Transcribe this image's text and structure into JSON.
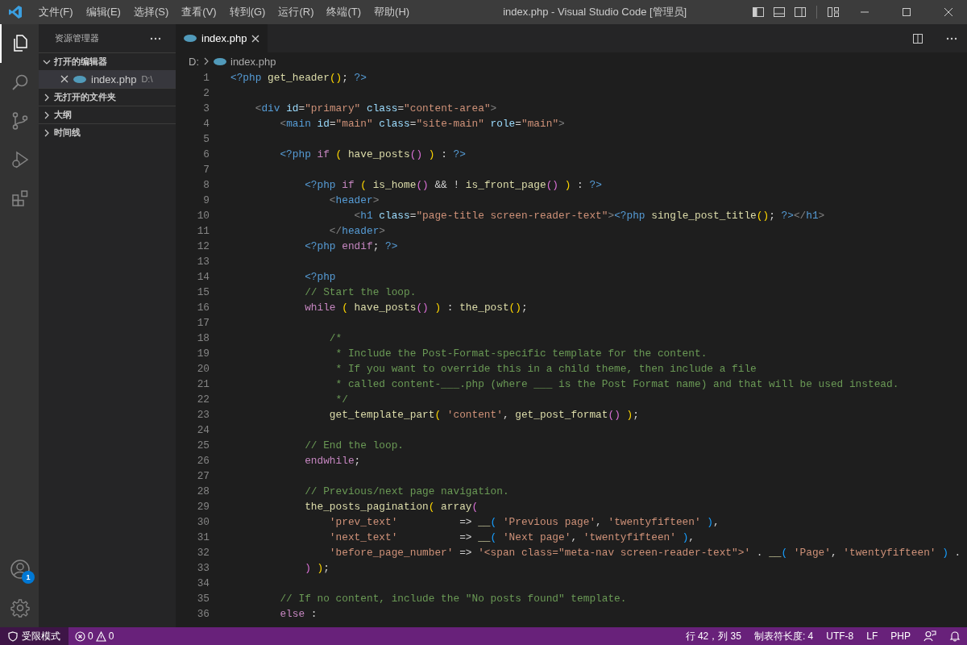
{
  "title_bar": {
    "menu": [
      "文件(F)",
      "编辑(E)",
      "选择(S)",
      "查看(V)",
      "转到(G)",
      "运行(R)",
      "终端(T)",
      "帮助(H)"
    ],
    "title": "index.php - Visual Studio Code [管理员]"
  },
  "activity_bar": {
    "account_badge": "1"
  },
  "sidebar": {
    "title": "资源管理器",
    "sections": [
      {
        "label": "打开的编辑器",
        "expanded": true,
        "items": [
          {
            "name": "index.php",
            "path": "D:\\",
            "selected": true
          }
        ]
      },
      {
        "label": "无打开的文件夹",
        "expanded": false
      },
      {
        "label": "大纲",
        "expanded": false
      },
      {
        "label": "时间线",
        "expanded": false
      }
    ]
  },
  "tabs": [
    {
      "label": "index.php",
      "selected": true
    }
  ],
  "breadcrumb": [
    "D:",
    "index.php"
  ],
  "editor": {
    "lines": [
      {
        "number": "1",
        "tokens": [
          {
            "kind": "d",
            "text": "<?php"
          },
          {
            "kind": "f",
            "text": " get_header"
          },
          {
            "kind": "y",
            "text": "()"
          },
          {
            "kind": "o",
            "text": ";"
          },
          {
            "kind": "d",
            "text": " ?>"
          }
        ]
      },
      {
        "number": "2"
      },
      {
        "number": "3",
        "tokens": [
          {
            "kind": "p",
            "text": "    <"
          },
          {
            "kind": "t",
            "text": "div"
          },
          {
            "kind": "a",
            "text": " id"
          },
          {
            "kind": "o",
            "text": "="
          },
          {
            "kind": "s",
            "text": "\"primary\""
          },
          {
            "kind": "a",
            "text": " class"
          },
          {
            "kind": "o",
            "text": "="
          },
          {
            "kind": "s",
            "text": "\"content-area\""
          },
          {
            "kind": "p",
            "text": ">"
          }
        ]
      },
      {
        "number": "4",
        "tokens": [
          {
            "kind": "p",
            "text": "        <"
          },
          {
            "kind": "t",
            "text": "main"
          },
          {
            "kind": "a",
            "text": " id"
          },
          {
            "kind": "o",
            "text": "="
          },
          {
            "kind": "s",
            "text": "\"main\""
          },
          {
            "kind": "a",
            "text": " class"
          },
          {
            "kind": "o",
            "text": "="
          },
          {
            "kind": "s",
            "text": "\"site-main\""
          },
          {
            "kind": "a",
            "text": " role"
          },
          {
            "kind": "o",
            "text": "="
          },
          {
            "kind": "s",
            "text": "\"main\""
          },
          {
            "kind": "p",
            "text": ">"
          }
        ]
      },
      {
        "number": "5"
      },
      {
        "number": "6",
        "tokens": [
          {
            "kind": "d",
            "text": "        <?php"
          },
          {
            "kind": "k",
            "text": " if"
          },
          {
            "kind": "y",
            "text": " ("
          },
          {
            "kind": "f",
            "text": " have_posts"
          },
          {
            "kind": "m",
            "text": "()"
          },
          {
            "kind": "y",
            "text": " )"
          },
          {
            "kind": "o",
            "text": " : "
          },
          {
            "kind": "d",
            "text": "?>"
          }
        ]
      },
      {
        "number": "7"
      },
      {
        "number": "8",
        "tokens": [
          {
            "kind": "d",
            "text": "            <?php"
          },
          {
            "kind": "k",
            "text": " if"
          },
          {
            "kind": "y",
            "text": " ("
          },
          {
            "kind": "f",
            "text": " is_home"
          },
          {
            "kind": "m",
            "text": "()"
          },
          {
            "kind": "o",
            "text": " && ! "
          },
          {
            "kind": "f",
            "text": "is_front_page"
          },
          {
            "kind": "m",
            "text": "()"
          },
          {
            "kind": "y",
            "text": " )"
          },
          {
            "kind": "o",
            "text": " : "
          },
          {
            "kind": "d",
            "text": "?>"
          }
        ]
      },
      {
        "number": "9",
        "tokens": [
          {
            "kind": "p",
            "text": "                <"
          },
          {
            "kind": "t",
            "text": "header"
          },
          {
            "kind": "p",
            "text": ">"
          }
        ]
      },
      {
        "number": "10",
        "tokens": [
          {
            "kind": "p",
            "text": "                    <"
          },
          {
            "kind": "t",
            "text": "h1"
          },
          {
            "kind": "a",
            "text": " class"
          },
          {
            "kind": "o",
            "text": "="
          },
          {
            "kind": "s",
            "text": "\"page-title screen-reader-text\""
          },
          {
            "kind": "p",
            "text": ">"
          },
          {
            "kind": "d",
            "text": "<?php"
          },
          {
            "kind": "f",
            "text": " single_post_title"
          },
          {
            "kind": "y",
            "text": "()"
          },
          {
            "kind": "o",
            "text": ";"
          },
          {
            "kind": "d",
            "text": " ?>"
          },
          {
            "kind": "p",
            "text": "</"
          },
          {
            "kind": "t",
            "text": "h1"
          },
          {
            "kind": "p",
            "text": ">"
          }
        ]
      },
      {
        "number": "11",
        "tokens": [
          {
            "kind": "p",
            "text": "                </"
          },
          {
            "kind": "t",
            "text": "header"
          },
          {
            "kind": "p",
            "text": ">"
          }
        ]
      },
      {
        "number": "12",
        "tokens": [
          {
            "kind": "d",
            "text": "            <?php"
          },
          {
            "kind": "k",
            "text": " endif"
          },
          {
            "kind": "o",
            "text": ";"
          },
          {
            "kind": "d",
            "text": " ?>"
          }
        ]
      },
      {
        "number": "13"
      },
      {
        "number": "14",
        "tokens": [
          {
            "kind": "d",
            "text": "            <?php"
          }
        ]
      },
      {
        "number": "15",
        "tokens": [
          {
            "kind": "c",
            "text": "            // Start the loop."
          }
        ]
      },
      {
        "number": "16",
        "tokens": [
          {
            "kind": "k",
            "text": "            while"
          },
          {
            "kind": "y",
            "text": " ("
          },
          {
            "kind": "f",
            "text": " have_posts"
          },
          {
            "kind": "m",
            "text": "()"
          },
          {
            "kind": "y",
            "text": " )"
          },
          {
            "kind": "o",
            "text": " : "
          },
          {
            "kind": "f",
            "text": "the_post"
          },
          {
            "kind": "y",
            "text": "()"
          },
          {
            "kind": "o",
            "text": ";"
          }
        ]
      },
      {
        "number": "17"
      },
      {
        "number": "18",
        "tokens": [
          {
            "kind": "c",
            "text": "                /*"
          }
        ]
      },
      {
        "number": "19",
        "tokens": [
          {
            "kind": "c",
            "text": "                 * Include the Post-Format-specific template for the content."
          }
        ]
      },
      {
        "number": "20",
        "tokens": [
          {
            "kind": "c",
            "text": "                 * If you want to override this in a child theme, then include a file"
          }
        ]
      },
      {
        "number": "21",
        "tokens": [
          {
            "kind": "c",
            "text": "                 * called content-___.php (where ___ is the Post Format name) and that will be used instead."
          }
        ]
      },
      {
        "number": "22",
        "tokens": [
          {
            "kind": "c",
            "text": "                 */"
          }
        ]
      },
      {
        "number": "23",
        "tokens": [
          {
            "kind": "f",
            "text": "                get_template_part"
          },
          {
            "kind": "y",
            "text": "("
          },
          {
            "kind": "s",
            "text": " 'content'"
          },
          {
            "kind": "o",
            "text": ", "
          },
          {
            "kind": "f",
            "text": "get_post_format"
          },
          {
            "kind": "m",
            "text": "()"
          },
          {
            "kind": "y",
            "text": " )"
          },
          {
            "kind": "o",
            "text": ";"
          }
        ]
      },
      {
        "number": "24"
      },
      {
        "number": "25",
        "tokens": [
          {
            "kind": "c",
            "text": "            // End the loop."
          }
        ]
      },
      {
        "number": "26",
        "tokens": [
          {
            "kind": "k",
            "text": "            endwhile"
          },
          {
            "kind": "o",
            "text": ";"
          }
        ]
      },
      {
        "number": "27"
      },
      {
        "number": "28",
        "tokens": [
          {
            "kind": "c",
            "text": "            // Previous/next page navigation."
          }
        ]
      },
      {
        "number": "29",
        "tokens": [
          {
            "kind": "f",
            "text": "            the_posts_pagination"
          },
          {
            "kind": "y",
            "text": "("
          },
          {
            "kind": "f",
            "text": " array"
          },
          {
            "kind": "m",
            "text": "("
          }
        ]
      },
      {
        "number": "30",
        "tokens": [
          {
            "kind": "s",
            "text": "                'prev_text'"
          },
          {
            "kind": "o",
            "text": "          => "
          },
          {
            "kind": "f",
            "text": "__"
          },
          {
            "kind": "b",
            "text": "("
          },
          {
            "kind": "s",
            "text": " 'Previous page'"
          },
          {
            "kind": "o",
            "text": ", "
          },
          {
            "kind": "s",
            "text": "'twentyfifteen'"
          },
          {
            "kind": "b",
            "text": " )"
          },
          {
            "kind": "o",
            "text": ","
          }
        ]
      },
      {
        "number": "31",
        "tokens": [
          {
            "kind": "s",
            "text": "                'next_text'"
          },
          {
            "kind": "o",
            "text": "          => "
          },
          {
            "kind": "f",
            "text": "__"
          },
          {
            "kind": "b",
            "text": "("
          },
          {
            "kind": "s",
            "text": " 'Next page'"
          },
          {
            "kind": "o",
            "text": ", "
          },
          {
            "kind": "s",
            "text": "'twentyfifteen'"
          },
          {
            "kind": "b",
            "text": " )"
          },
          {
            "kind": "o",
            "text": ","
          }
        ]
      },
      {
        "number": "32",
        "tokens": [
          {
            "kind": "s",
            "text": "                'before_page_number'"
          },
          {
            "kind": "o",
            "text": " => "
          },
          {
            "kind": "s",
            "text": "'<span class=\"meta-nav screen-reader-text\">'"
          },
          {
            "kind": "o",
            "text": " . "
          },
          {
            "kind": "f",
            "text": "__"
          },
          {
            "kind": "b",
            "text": "("
          },
          {
            "kind": "s",
            "text": " 'Page'"
          },
          {
            "kind": "o",
            "text": ", "
          },
          {
            "kind": "s",
            "text": "'twentyfifteen'"
          },
          {
            "kind": "b",
            "text": " )"
          },
          {
            "kind": "o",
            "text": " ."
          }
        ]
      },
      {
        "number": "33",
        "tokens": [
          {
            "kind": "m",
            "text": "            )"
          },
          {
            "kind": "y",
            "text": " )"
          },
          {
            "kind": "o",
            "text": ";"
          }
        ]
      },
      {
        "number": "34"
      },
      {
        "number": "35",
        "tokens": [
          {
            "kind": "c",
            "text": "        // If no content, include the \"No posts found\" template."
          }
        ]
      },
      {
        "number": "36",
        "tokens": [
          {
            "kind": "k",
            "text": "        else"
          },
          {
            "kind": "o",
            "text": " :"
          }
        ]
      }
    ]
  },
  "status_bar": {
    "restricted_mode": "受限模式",
    "errors": "0",
    "warnings": "0",
    "items": [
      "行 42，列 35",
      "制表符长度: 4",
      "UTF-8",
      "LF",
      "PHP"
    ]
  }
}
